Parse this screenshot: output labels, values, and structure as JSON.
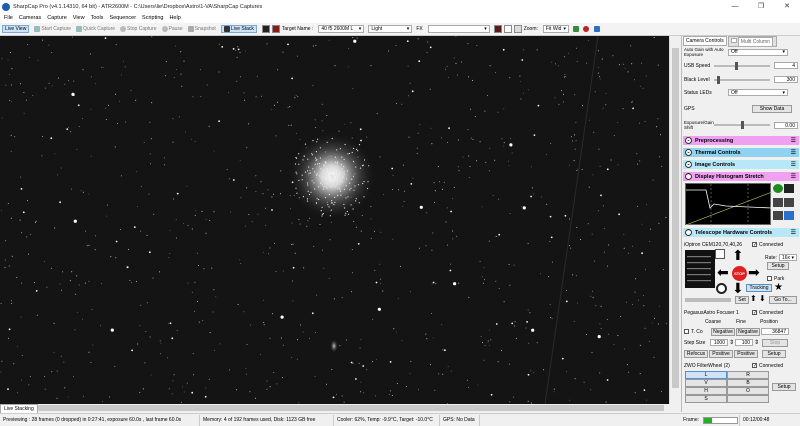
{
  "window": {
    "title": "SharpCap Pro (v4.1.14310, 64 bit) - ATR2600M - C:\\Users\\lie\\Dropbox\\Astro\\1-VA\\SharpCap Captures",
    "minimize": "—",
    "maximize": "❐",
    "close": "✕"
  },
  "menu": [
    "File",
    "Cameras",
    "Capture",
    "View",
    "Tools",
    "Sequencer",
    "Scripting",
    "Help"
  ],
  "toolbar": {
    "live_view": "Live View",
    "start_capture": "Start Capture",
    "quick_capture": "Quick Capture",
    "stop_capture": "Stop Capture",
    "pause": "Pause",
    "snapshot": "Snapshot",
    "live_stack": "Live Stack",
    "target_name_label": "Target Name :",
    "target_name_value": "40 f5 2600M L",
    "filter_value": "Light",
    "fx_label": "FX",
    "fx_value": "",
    "zoom_label": "Zoom:",
    "zoom_value": "Fit Wid"
  },
  "bottom_tab": "Live Stacking",
  "panel": {
    "tabs": [
      "Camera Controls",
      "Multi Column"
    ],
    "auto_gain_label": "Auto Gain with Auto Exposure",
    "auto_gain_value": "Off",
    "usb_speed_label": "USB Speed",
    "usb_speed_value": "4",
    "usb_speed_level": 0.4,
    "black_level_label": "Black Level",
    "black_level_value": "300",
    "black_level_level": 0.05,
    "status_leds_label": "Status LEDs",
    "status_leds_value": "Off",
    "gps_label": "GPS",
    "show_data": "Show Data",
    "exposure_gain_label": "Exposure/Gain Shift",
    "exposure_gain_value": "0.00",
    "exposure_gain_level": 0.5,
    "sections": {
      "preprocessing": "Preprocessing",
      "thermal": "Thermal Controls",
      "image": "Image Controls",
      "histogram": "Display Histogram Stretch",
      "telescope": "Telescope Hardware Controls"
    },
    "mount": {
      "name": "iOptron CEM120,70,40,26",
      "connected": "Connected",
      "rate_label": "Rate:",
      "rate_value": "16x",
      "setup": "Setup",
      "park": "Park",
      "stop": "STOP",
      "tracking": "Tracking",
      "set": "Set",
      "goto": "Go To..."
    },
    "focuser": {
      "name": "PegasusAstro Focuser 1",
      "connected": "Connected",
      "coarse": "Coarse",
      "fine": "Fine",
      "position": "Position",
      "tc": "T. Co",
      "negative1": "Negative",
      "negative2": "Negative",
      "position_value": "36847",
      "step_size_label": "Step Size",
      "step1": "1000",
      "step2": "100",
      "stop": "Stop",
      "refocus": "Refocus",
      "positive1": "Positive",
      "positive2": "Positive",
      "setup": "Setup"
    },
    "filterwheel": {
      "name": "ZWO FilterWheel (2)",
      "connected": "Connected",
      "setup": "Setup",
      "filters": [
        [
          "L",
          "R"
        ],
        [
          "V",
          "B"
        ],
        [
          "H",
          "O"
        ],
        [
          "S",
          ""
        ]
      ]
    }
  },
  "status": {
    "previewing": "Previewing : 28 frames (0 dropped) in 0:27:41, exposure 60.0s , last frame 60.0s",
    "memory": "Memory: 4 of 192 frames used, Disk: 1123 GB free",
    "cooler": "Cooler: 62%, Temp: -9.9°C, Target: -10.0°C",
    "gps": "GPS: No Data",
    "frame_label": "Frame:",
    "time": "00:12/00:48"
  },
  "colors": {
    "preprocessing": "#f0a0f0",
    "thermal": "#8fd3f0",
    "image": "#b8e8f8",
    "histogram": "#f0a0f0",
    "telescope": "#b8e8f8",
    "stop": "#e02020",
    "frame_progress": "#22b022"
  }
}
